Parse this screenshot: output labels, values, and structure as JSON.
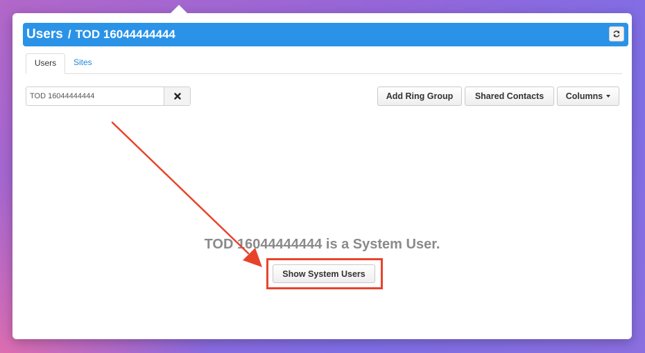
{
  "header": {
    "title": "Users",
    "separator": "/",
    "subtitle": "TOD 16044444444",
    "refresh_icon": "refresh-icon",
    "accent_color": "#2a93e8"
  },
  "tabs": [
    {
      "label": "Users",
      "active": true
    },
    {
      "label": "Sites",
      "active": false
    }
  ],
  "search": {
    "value": "TOD 16044444444",
    "clear_icon": "close-icon"
  },
  "toolbar": {
    "add_ring_group_label": "Add Ring Group",
    "shared_contacts_label": "Shared Contacts",
    "columns_label": "Columns"
  },
  "main": {
    "message": "TOD 16044444444 is a System User.",
    "show_system_users_label": "Show System Users"
  },
  "annotation": {
    "color": "#e8432a"
  }
}
